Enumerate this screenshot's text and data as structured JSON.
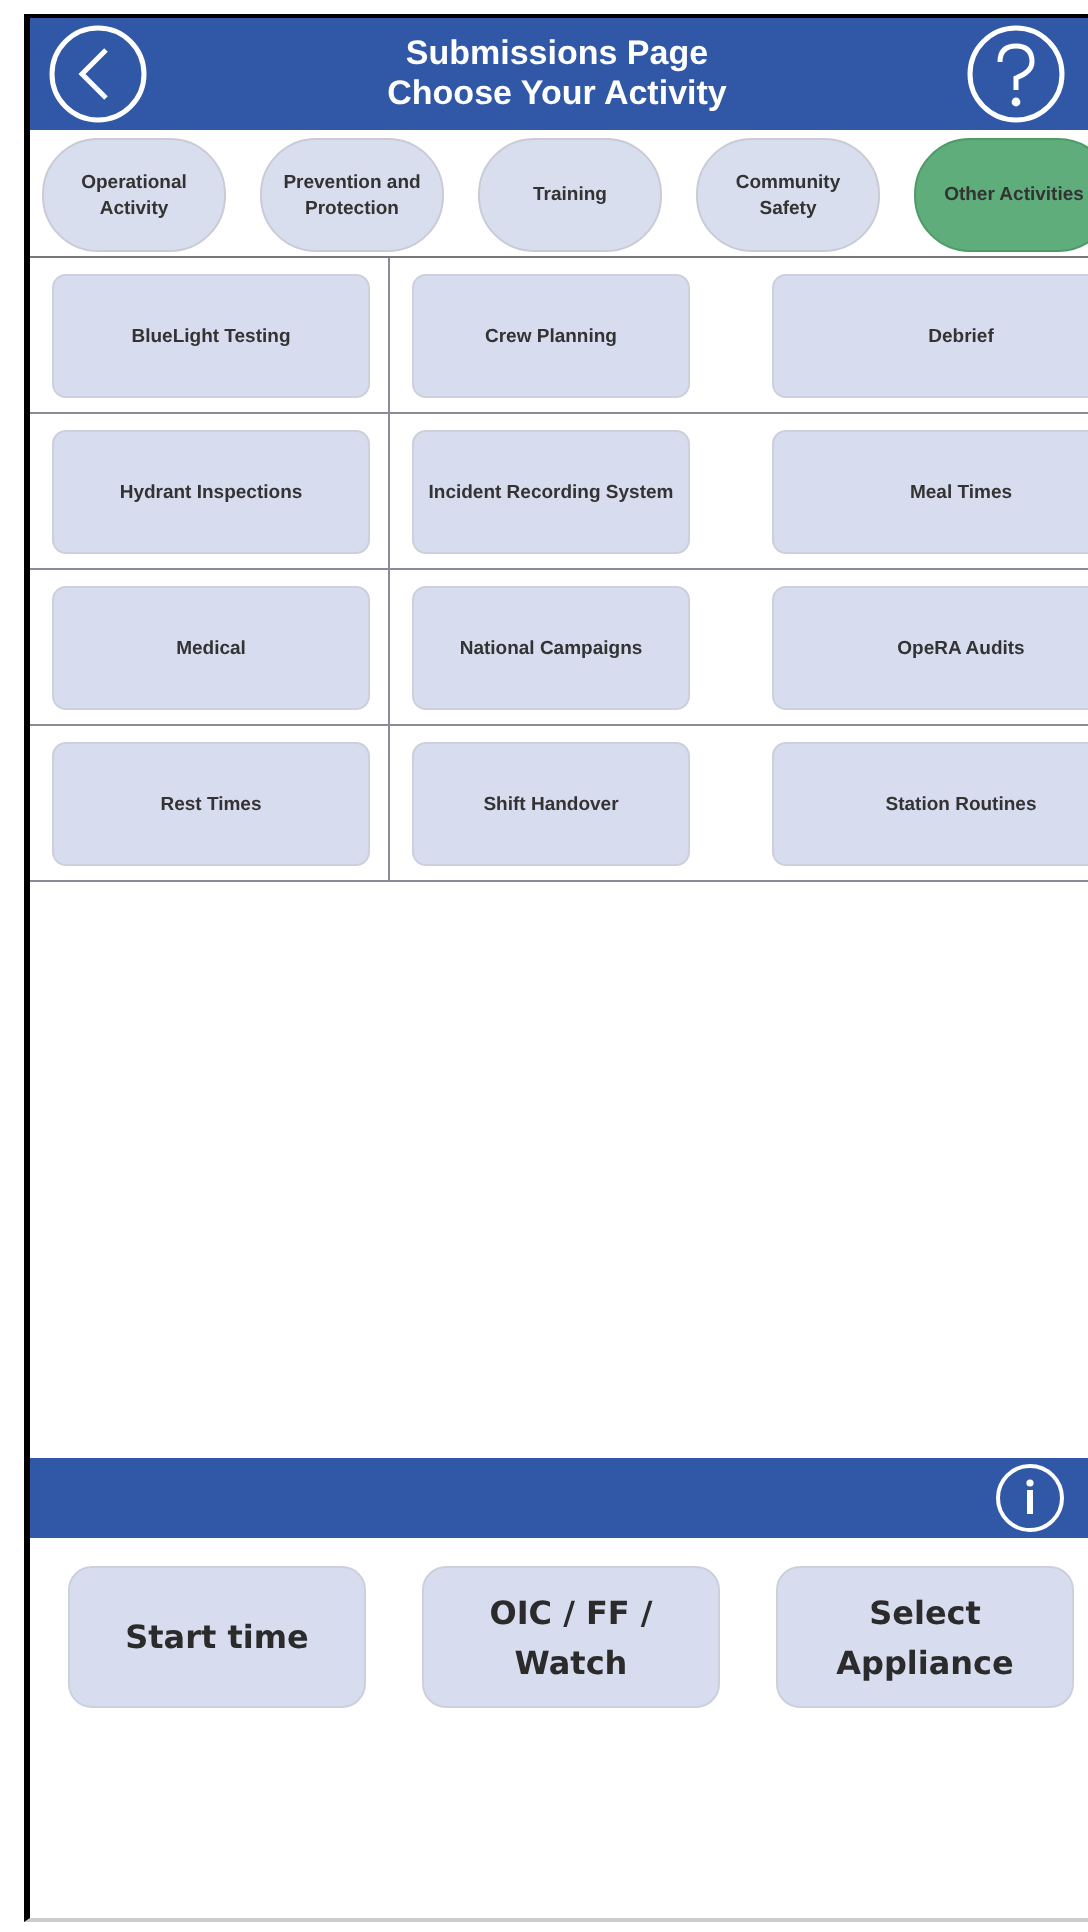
{
  "header": {
    "title": "Submissions Page",
    "subtitle": "Choose Your Activity"
  },
  "tabs": [
    {
      "label": "Operational\nActivity",
      "selected": false
    },
    {
      "label": "Prevention and\nProtection",
      "selected": false
    },
    {
      "label": "Training",
      "selected": false
    },
    {
      "label": "Community\nSafety",
      "selected": false
    },
    {
      "label": "Other Activities",
      "selected": true
    }
  ],
  "activities": [
    "BlueLight Testing",
    "Crew Planning",
    "Debrief",
    "Hydrant Inspections",
    "Incident Recording System",
    "Meal Times",
    "Medical",
    "National Campaigns",
    "OpeRA Audits",
    "Rest Times",
    "Shift Handover",
    "Station Routines"
  ],
  "bottom_buttons": [
    "Start time",
    "OIC / FF /\nWatch",
    "Select\nAppliance"
  ]
}
